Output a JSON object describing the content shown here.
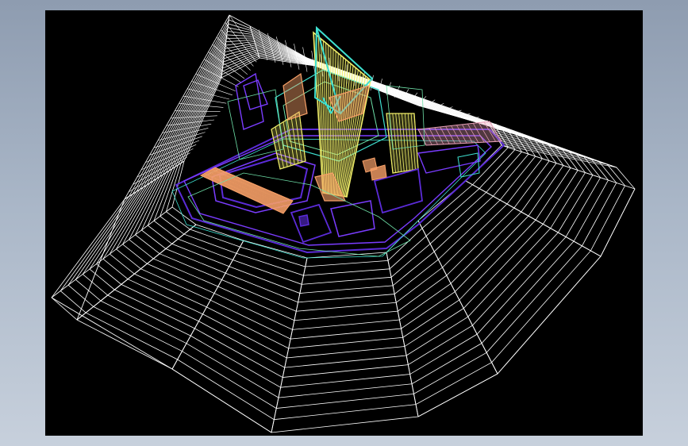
{
  "window": {
    "background_colors": [
      "#8e9cb0",
      "#a9b6c7",
      "#c7d0dc"
    ]
  },
  "viewport": {
    "background": "#000000",
    "content": "cad-wireframe-3d-model"
  },
  "wireframe": {
    "terrain_color": "#ffffff",
    "colors": {
      "structure_purple": "#5b2bd8",
      "structure_violet": "#7a3cff",
      "structure_cyan": "#3ee0d0",
      "roof_yellow": "#f2f06a",
      "roof_orange": "#f7a068",
      "roof_pink": "#e8a0b8",
      "frame_green": "#6ee0a8"
    }
  }
}
